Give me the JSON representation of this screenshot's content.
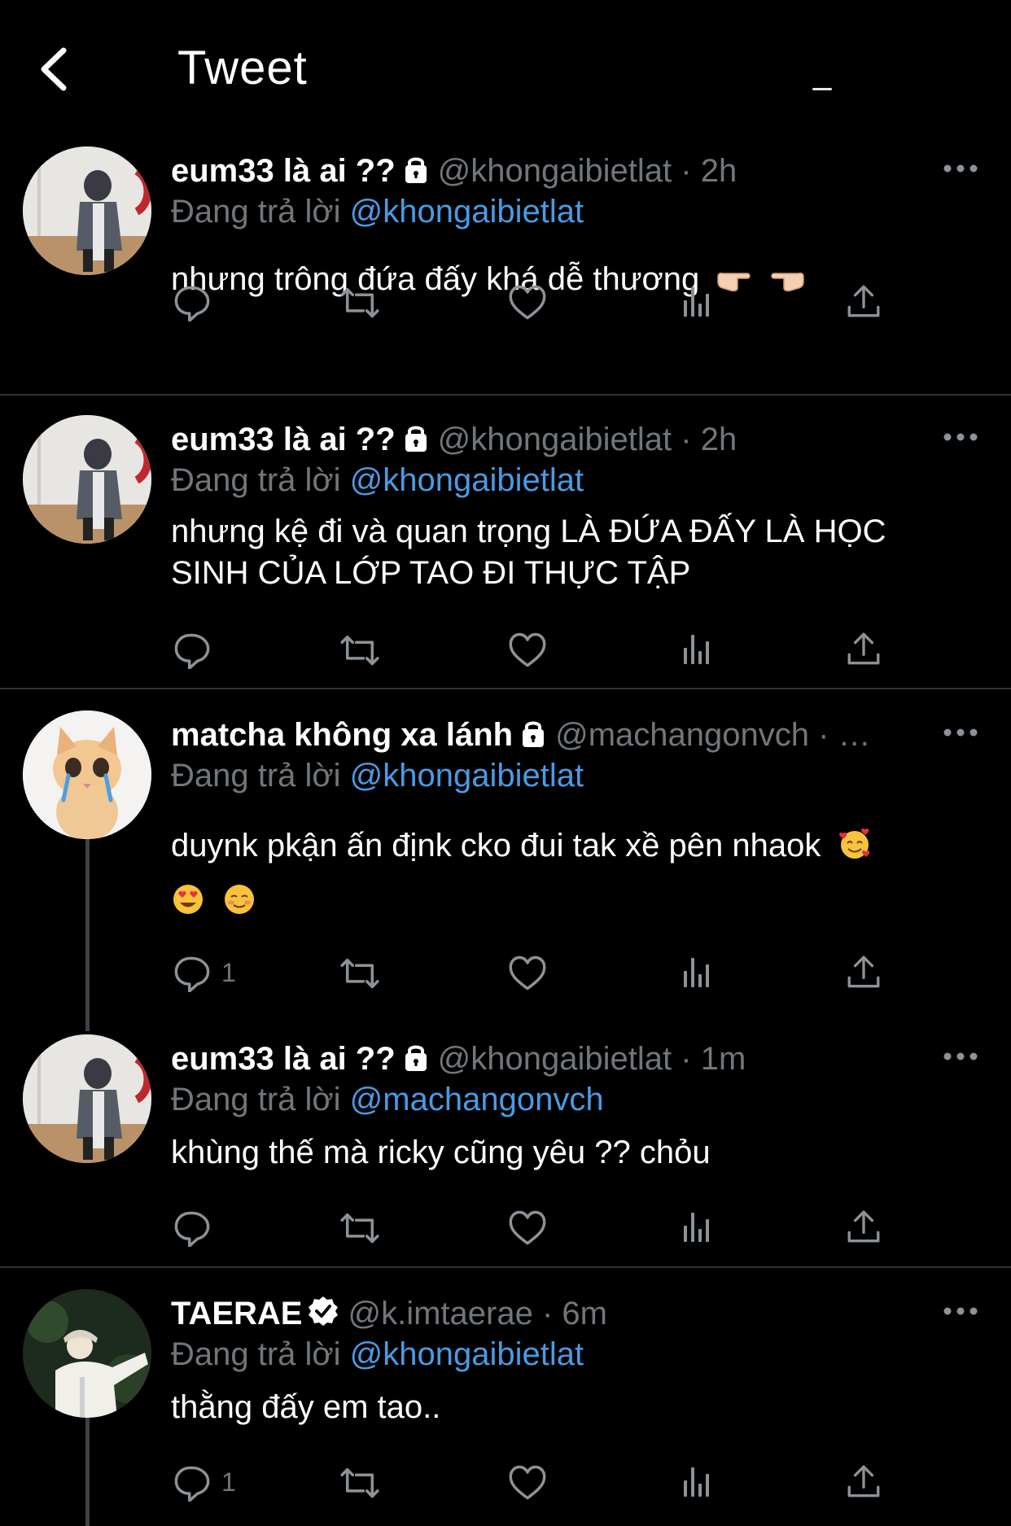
{
  "header": {
    "title": "Tweet"
  },
  "reply_prefix": "Đang trả lời",
  "tweets": [
    {
      "name": "eum33 là ai ??",
      "handle": "@khongaibietlat",
      "time": "· 2h",
      "reply_to": "@khongaibietlat",
      "text": "nhưng trông đứa đấy khá dễ thương",
      "text_emoji": [
        "backhand-index-right",
        "backhand-index-left"
      ],
      "reply_count": ""
    },
    {
      "name": "eum33 là ai ??",
      "handle": "@khongaibietlat",
      "time": "· 2h",
      "reply_to": "@khongaibietlat",
      "text": "nhưng kệ đi và quan trọng LÀ ĐỨA ĐẤY LÀ HỌC SINH CỦA LỚP TAO ĐI THỰC TẬP",
      "reply_count": ""
    },
    {
      "name": "matcha không xa lánh",
      "handle": "@machangonvch",
      "time": "· …",
      "reply_to": "@khongaibietlat",
      "text": "duynk pkận ấn địnk cko đui tak xề pên nhaok",
      "text_emoji": [
        "smiling-face-with-hearts",
        "heart-eyes",
        "smiling-face"
      ],
      "reply_count": "1"
    },
    {
      "name": "eum33 là ai ??",
      "handle": "@khongaibietlat",
      "time": "· 1m",
      "reply_to": "@machangonvch",
      "text": "khùng thế mà ricky cũng yêu ?? chỏu",
      "reply_count": ""
    },
    {
      "name": "TAERAE",
      "handle": "@k.imtaerae",
      "time": "· 6m",
      "reply_to": "@khongaibietlat",
      "text": "thằng đấy em tao..",
      "verified": true,
      "reply_count": "1"
    }
  ],
  "colors": {
    "background": "#000000",
    "muted": "#71767b",
    "link": "#4a9ae3",
    "separator": "#2f3336"
  }
}
